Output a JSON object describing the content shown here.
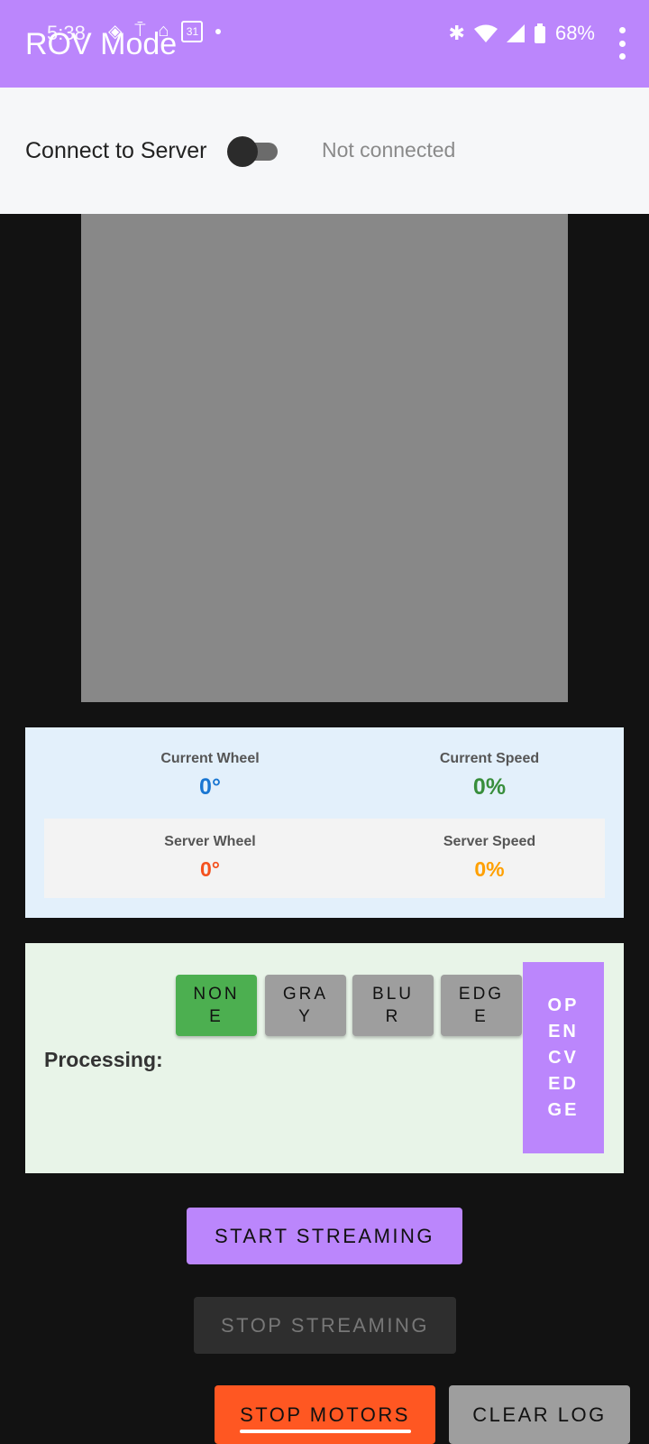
{
  "status_bar": {
    "time": "5:38",
    "battery": "68%"
  },
  "app_bar": {
    "title": "ROV Mode"
  },
  "connect": {
    "label": "Connect to Server",
    "status": "Not connected",
    "switch_on": false
  },
  "telemetry": {
    "current_wheel_label": "Current Wheel",
    "current_wheel_value": "0°",
    "current_speed_label": "Current Speed",
    "current_speed_value": "0%",
    "server_wheel_label": "Server Wheel",
    "server_wheel_value": "0°",
    "server_speed_label": "Server Speed",
    "server_speed_value": "0%"
  },
  "processing": {
    "label": "Processing:",
    "none": "NONE",
    "gray": "GRAY",
    "blur": "BLUR",
    "edge": "EDGE",
    "opencv_edge": "OPENCVEDGE"
  },
  "buttons": {
    "start_streaming": "START STREAMING",
    "stop_streaming": "STOP STREAMING",
    "stop_motors": "STOP MOTORS",
    "clear_log": "CLEAR LOG"
  },
  "colors": {
    "accent": "#bb86fc",
    "wheel_blue": "#1976d2",
    "speed_green": "#388e3c",
    "server_wheel_orange": "#f4511e",
    "server_speed_amber": "#ffa000",
    "active_green": "#4caf50",
    "stop_orange": "#ff5722"
  }
}
